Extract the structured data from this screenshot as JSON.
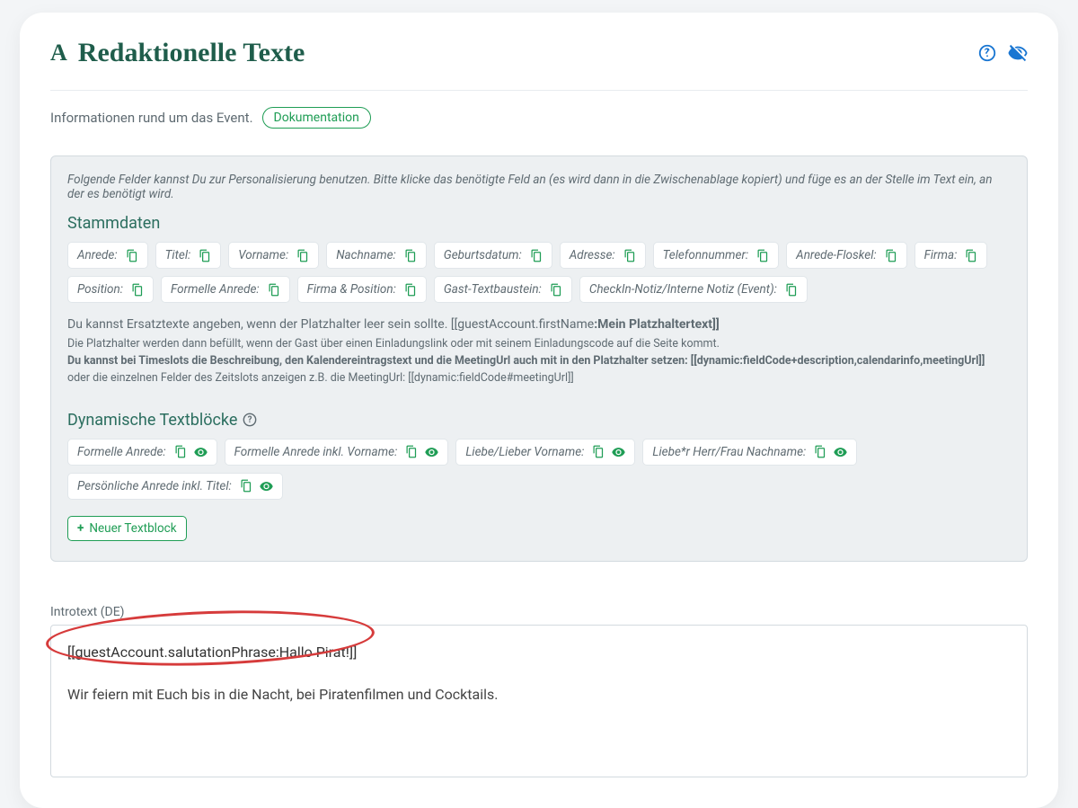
{
  "header": {
    "title": "Redaktionelle Texte",
    "title_glyph": "A"
  },
  "intro": {
    "text": "Informationen rund um das Event.",
    "doc_label": "Dokumentation"
  },
  "panel": {
    "lead": "Folgende Felder kannst Du zur Personalisierung benutzen. Bitte klicke das benötigte Feld an (es wird dann in die Zwischenablage kopiert) und füge es an der Stelle im Text ein, an der es benötigt wird.",
    "stamm_title": "Stammdaten",
    "stamm_chips": [
      "Anrede:",
      "Titel:",
      "Vorname:",
      "Nachname:",
      "Geburtsdatum:",
      "Adresse:",
      "Telefonnummer:",
      "Anrede-Floskel:",
      "Firma:",
      "Position:",
      "Formelle Anrede:",
      "Firma & Position:",
      "Gast-Textbaustein:",
      "CheckIn-Notiz/Interne Notiz (Event):"
    ],
    "explain_line1_a": "Du kannst Ersatztexte angeben, wenn der Platzhalter leer sein sollte. ",
    "explain_line1_b_plain": "[[guestAccount.firstName",
    "explain_line1_b_bold": ":Mein Platzhaltertext]]",
    "explain_line2": "Die Platzhalter werden dann befüllt, wenn der Gast über einen Einladungslink oder mit seinem Einladungscode auf die Seite kommt.",
    "explain_line3_bold": "Du kannst bei Timeslots die Beschreibung, den Kalendereintragstext und die MeetingUrl auch mit in den Platzhalter setzen: [[dynamic:fieldCode+description,calendarinfo,meetingUrl]]",
    "explain_line4": "oder die einzelnen Felder des Zeitslots anzeigen z.B. die MeetingUrl: [[dynamic:fieldCode#meetingUrl]]",
    "dyn_title": "Dynamische Textblöcke",
    "dyn_chips": [
      "Formelle Anrede:",
      "Formelle Anrede inkl. Vorname:",
      "Liebe/Lieber Vorname:",
      "Liebe*r Herr/Frau Nachname:",
      "Persönliche Anrede inkl. Titel:"
    ],
    "new_block": "Neuer Textblock"
  },
  "editor": {
    "label": "Introtext (DE)",
    "line1": "[[guestAccount.salutationPhrase:Hallo Pirat!]]",
    "line2": "Wir feiern mit Euch bis in die Nacht, bei Piratenfilmen und Cocktails."
  }
}
